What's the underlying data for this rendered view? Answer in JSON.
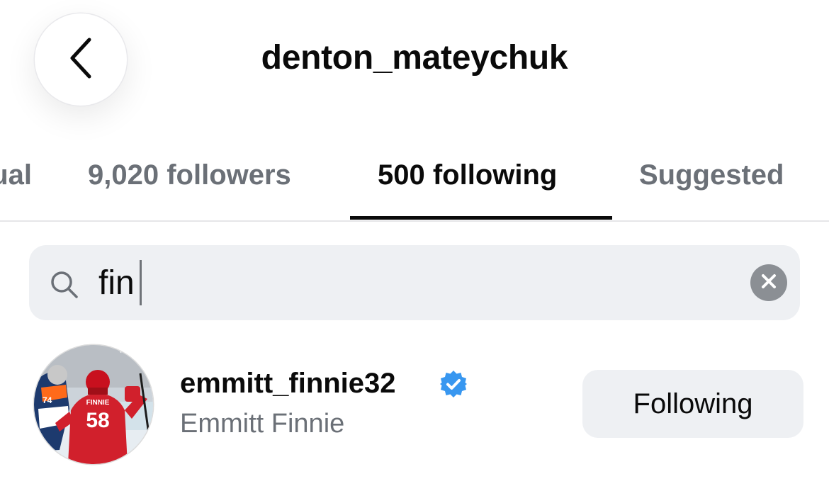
{
  "header": {
    "title": "denton_mateychuk",
    "back_icon": "chevron-left-icon"
  },
  "tabs": [
    {
      "label": "Mutual",
      "visible_text": "ual",
      "active": false
    },
    {
      "label": "9,020 followers",
      "active": false
    },
    {
      "label": "500 following",
      "active": true
    },
    {
      "label": "Suggested",
      "active": false
    }
  ],
  "search": {
    "value": "fin",
    "icon": "search-icon",
    "clear_icon": "clear-icon"
  },
  "results": [
    {
      "username": "emmitt_finnie32",
      "full_name": "Emmitt Finnie",
      "verified": true,
      "button_label": "Following",
      "avatar": {
        "jersey_number": "58",
        "jersey_name": "FINNIE",
        "opponent_number": "74"
      }
    }
  ],
  "colors": {
    "text": "#0a0a0a",
    "secondary_text": "#6b7077",
    "search_bg": "#eef0f3",
    "verified_blue": "#3897f0",
    "jersey_red": "#d1202c"
  }
}
